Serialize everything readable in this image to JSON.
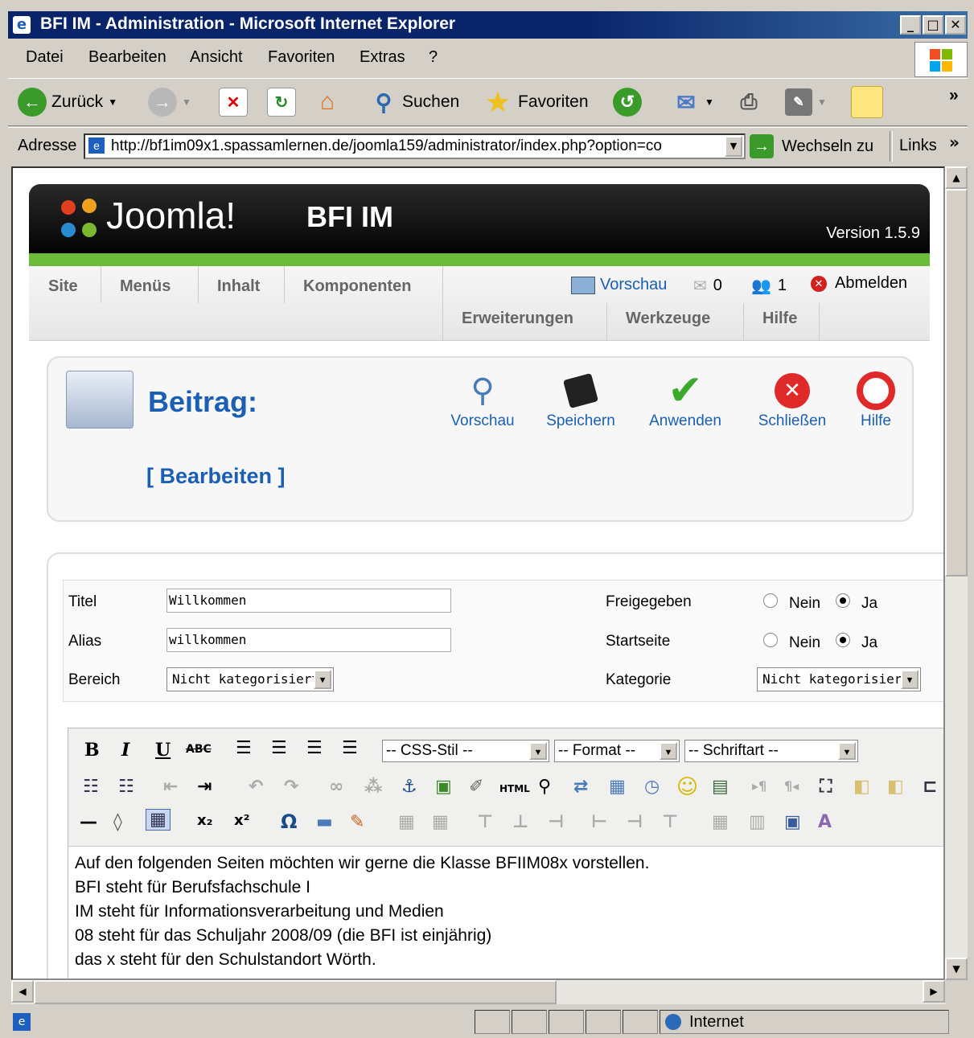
{
  "window": {
    "title": "BFI IM - Administration - Microsoft Internet Explorer"
  },
  "menu": [
    "Datei",
    "Bearbeiten",
    "Ansicht",
    "Favoriten",
    "Extras",
    "?"
  ],
  "toolbar": {
    "back": "Zurück",
    "search": "Suchen",
    "favorites": "Favoriten",
    "more": "»"
  },
  "address": {
    "label": "Adresse",
    "url": "http://bf1im09x1.spassamlernen.de/joomla159/administrator/index.php?option=co",
    "go": "Wechseln zu",
    "links": "Links",
    "more": "»"
  },
  "joomla": {
    "logo": "Joomla!",
    "site_name": "BFI IM",
    "version": "Version 1.5.9",
    "nav": [
      "Site",
      "Menüs",
      "Inhalt",
      "Komponenten",
      "Erweiterungen",
      "Werkzeuge",
      "Hilfe"
    ],
    "status": {
      "preview": "Vorschau",
      "messages": "0",
      "users": "1",
      "logout": "Abmelden"
    }
  },
  "page": {
    "title": "Beitrag:",
    "subtitle": "[ Bearbeiten ]",
    "actions": [
      "Vorschau",
      "Speichern",
      "Anwenden",
      "Schließen",
      "Hilfe"
    ]
  },
  "form": {
    "title_label": "Titel",
    "title_value": "Willkommen",
    "alias_label": "Alias",
    "alias_value": "willkommen",
    "section_label": "Bereich",
    "section_value": "Nicht kategorisiert",
    "published_label": "Freigegeben",
    "frontpage_label": "Startseite",
    "category_label": "Kategorie",
    "category_value": "Nicht kategorisiert",
    "no": "Nein",
    "yes": "Ja",
    "published": "Ja",
    "frontpage": "Ja"
  },
  "editor": {
    "css_style": "-- CSS-Stil --",
    "format": "-- Format --",
    "font": "-- Schriftart --",
    "lines": [
      "Auf den folgenden Seiten möchten wir gerne die Klasse BFIIM08x vorstellen.",
      "BFI steht für Berufsfachschule I",
      "IM steht für Informationsverarbeitung und Medien",
      "08 steht für das Schuljahr 2008/09 (die BFI ist einjährig)",
      "das x steht für den Schulstandort Wörth."
    ]
  },
  "status": {
    "zone": "Internet"
  },
  "colors": {
    "titlebar": "#0a246a",
    "joomla_green": "#6cba3a",
    "joomla_blue": "#1a5fb4",
    "link_blue": "#1a5fb4"
  }
}
